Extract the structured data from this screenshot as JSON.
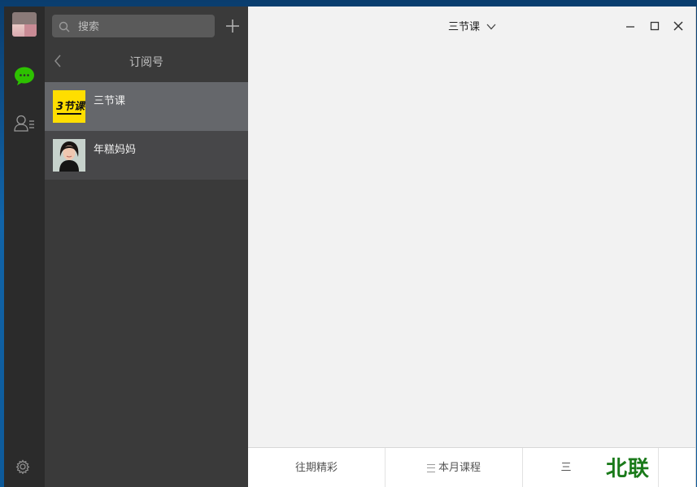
{
  "rail": {
    "avatar": "user-avatar",
    "icons": [
      "chat-icon",
      "contacts-icon",
      "settings-icon"
    ],
    "accent": "#2dc100"
  },
  "sidebar": {
    "search_placeholder": "搜索",
    "add_label": "+",
    "sub_title": "订阅号",
    "items": [
      {
        "name": "三节课",
        "active": true,
        "logo_text": "3节课"
      },
      {
        "name": "年糕妈妈",
        "active": false
      }
    ]
  },
  "main": {
    "title": "三节课",
    "menu": [
      {
        "label": "往期精彩"
      },
      {
        "label": "本月课程"
      },
      {
        "label": "三"
      }
    ],
    "watermark": "北联"
  }
}
